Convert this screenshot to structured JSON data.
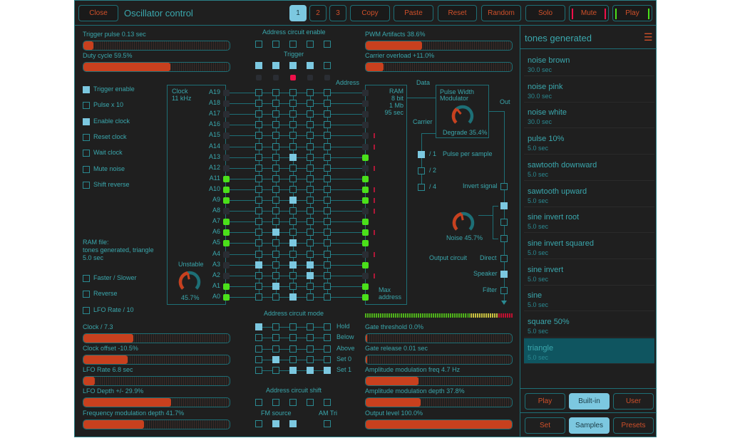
{
  "toolbar": {
    "close": "Close",
    "title": "Oscillator control",
    "pages": [
      "1",
      "2",
      "3"
    ],
    "active_page": "1",
    "copy": "Copy",
    "paste": "Paste",
    "reset": "Reset",
    "random": "Random",
    "solo": "Solo",
    "mute": "Mute",
    "play": "Play"
  },
  "sliders": {
    "trigger_pulse": {
      "label": "Trigger pulse 0.13 sec",
      "value": 7
    },
    "duty_cycle": {
      "label": "Duty cycle 59.5%",
      "value": 59.5
    },
    "pwm_artifacts": {
      "label": "PWM Artifacts 38.6%",
      "value": 38.6
    },
    "carrier_overload": {
      "label": "Carrier overload +11.0%",
      "value": 12
    },
    "clock_div": {
      "label": "Clock / 7.3",
      "value": 34
    },
    "clock_offset": {
      "label": "Clock offset -10.5%",
      "value": 30
    },
    "lfo_rate": {
      "label": "LFO Rate 6.8 sec",
      "value": 8
    },
    "lfo_depth": {
      "label": "LFO Depth +/- 29.9%",
      "value": 60
    },
    "fm_depth": {
      "label": "Frequency modulation depth 41.7%",
      "value": 41.7
    },
    "gate_threshold": {
      "label": "Gate threshold 0.0%",
      "value": 1
    },
    "gate_release": {
      "label": "Gate release 0.01 sec",
      "value": 1
    },
    "am_freq": {
      "label": "Amplitude modulation freq 4.7 Hz",
      "value": 36
    },
    "am_depth": {
      "label": "Amplitude modulation depth 37.8%",
      "value": 37.8
    },
    "output_level": {
      "label": "Output level 100.0%",
      "value": 100
    }
  },
  "options": [
    {
      "label": "Trigger enable",
      "checked": true
    },
    {
      "label": "Pulse x 10",
      "checked": false
    },
    {
      "label": "Enable clock",
      "checked": true
    },
    {
      "label": "Reset clock",
      "checked": false
    },
    {
      "label": "Wait clock",
      "checked": false
    },
    {
      "label": "Mute noise",
      "checked": false
    },
    {
      "label": "Shift reverse",
      "checked": false
    }
  ],
  "ram_file": {
    "line1": "RAM file:",
    "line2": "tones generated, triangle",
    "line3": "5.0 sec"
  },
  "ram_options": [
    {
      "label": "Faster / Slower",
      "checked": false
    },
    {
      "label": "Reverse",
      "checked": false
    },
    {
      "label": "LFO Rate / 10",
      "checked": false
    }
  ],
  "clock": {
    "label": "Clock",
    "freq": "11 kHz",
    "unstable_label": "Unstable",
    "unstable_value": "45.7%",
    "unstable_fraction": 0.457
  },
  "address": {
    "enable_label": "Address circuit enable",
    "enable": [
      false,
      false,
      false,
      false,
      false
    ],
    "trigger_label": "Trigger",
    "trigger": [
      true,
      true,
      true,
      true,
      false
    ],
    "trigger_leds": [
      false,
      false,
      true,
      false,
      false
    ],
    "address_label": "Address",
    "data_label": "Data",
    "rows": [
      {
        "label": "A19",
        "cols": [],
        "in": false,
        "out": false,
        "mark": false
      },
      {
        "label": "A18",
        "cols": [],
        "in": false,
        "out": false,
        "mark": false
      },
      {
        "label": "A17",
        "cols": [],
        "in": false,
        "out": false,
        "mark": false
      },
      {
        "label": "A16",
        "cols": [],
        "in": false,
        "out": false,
        "mark": false
      },
      {
        "label": "A15",
        "cols": [],
        "in": false,
        "out": false,
        "mark": true
      },
      {
        "label": "A14",
        "cols": [],
        "in": false,
        "out": false,
        "mark": true
      },
      {
        "label": "A13",
        "cols": [
          3
        ],
        "in": false,
        "out": true,
        "mark": false
      },
      {
        "label": "A12",
        "cols": [],
        "in": false,
        "out": false,
        "mark": true
      },
      {
        "label": "A11",
        "cols": [],
        "in": true,
        "out": true,
        "mark": false
      },
      {
        "label": "A10",
        "cols": [],
        "in": true,
        "out": true,
        "mark": true
      },
      {
        "label": "A9",
        "cols": [
          3
        ],
        "in": true,
        "out": true,
        "mark": true
      },
      {
        "label": "A8",
        "cols": [],
        "in": false,
        "out": false,
        "mark": true
      },
      {
        "label": "A7",
        "cols": [],
        "in": true,
        "out": true,
        "mark": false
      },
      {
        "label": "A6",
        "cols": [
          2
        ],
        "in": true,
        "out": true,
        "mark": true
      },
      {
        "label": "A5",
        "cols": [
          3
        ],
        "in": true,
        "out": true,
        "mark": false
      },
      {
        "label": "A4",
        "cols": [],
        "in": false,
        "out": false,
        "mark": true
      },
      {
        "label": "A3",
        "cols": [
          1,
          3,
          4
        ],
        "in": false,
        "out": true,
        "mark": false
      },
      {
        "label": "A2",
        "cols": [
          4
        ],
        "in": false,
        "out": false,
        "mark": true
      },
      {
        "label": "A1",
        "cols": [
          2
        ],
        "in": true,
        "out": true,
        "mark": false
      },
      {
        "label": "A0",
        "cols": [
          3
        ],
        "in": true,
        "out": true,
        "mark": false
      }
    ],
    "mode_label": "Address circuit mode",
    "modes": [
      {
        "label": "Hold",
        "cols": [
          1
        ]
      },
      {
        "label": "Below",
        "cols": []
      },
      {
        "label": "Above",
        "cols": []
      },
      {
        "label": "Set 0",
        "cols": [
          2
        ]
      },
      {
        "label": "Set 1",
        "cols": [
          3,
          4,
          5
        ]
      }
    ],
    "shift_label": "Address circuit shift",
    "shift": [
      false,
      false,
      false,
      false,
      false
    ],
    "fm_label": "FM source",
    "fm": [
      false,
      true,
      true
    ],
    "am_label": "AM Tri",
    "am": false
  },
  "ram": {
    "l1": "RAM",
    "l2": "8 bit",
    "l3": "1 Mb",
    "l4": "95 sec",
    "max1": "Max",
    "max2": "address"
  },
  "pwm": {
    "title1": "Pulse Width",
    "title2": "Modulator",
    "degrade": "Degrade 35.4%",
    "degrade_fraction": 0.354,
    "carrier": "Carrier",
    "out": "Out",
    "divs": [
      {
        "label": "/ 1",
        "checked": true
      },
      {
        "label": "/ 2",
        "checked": false
      },
      {
        "label": "/ 4",
        "checked": false
      }
    ],
    "pulse_per_sample": "Pulse per sample",
    "invert": "Invert signal",
    "invert_checked": false,
    "noise": "Noise 45.7%",
    "noise_fraction": 0.457,
    "noise_sel": [
      true,
      false,
      false
    ],
    "output_circuit": "Output circuit",
    "outputs": [
      {
        "label": "Direct",
        "checked": false
      },
      {
        "label": "Speaker",
        "checked": true
      },
      {
        "label": "Filter",
        "checked": false
      }
    ],
    "meter_level": 1.0
  },
  "sidebar": {
    "title": "tones generated",
    "items": [
      {
        "name": "noise brown",
        "dur": "30.0 sec"
      },
      {
        "name": "noise pink",
        "dur": "30.0 sec"
      },
      {
        "name": "noise white",
        "dur": "30.0 sec"
      },
      {
        "name": "pulse 10%",
        "dur": "5.0 sec"
      },
      {
        "name": "sawtooth downward",
        "dur": "5.0 sec"
      },
      {
        "name": "sawtooth upward",
        "dur": "5.0 sec"
      },
      {
        "name": "sine invert root",
        "dur": "5.0 sec"
      },
      {
        "name": "sine invert squared",
        "dur": "5.0 sec"
      },
      {
        "name": "sine invert",
        "dur": "5.0 sec"
      },
      {
        "name": "sine",
        "dur": "5.0 sec"
      },
      {
        "name": "square 50%",
        "dur": "5.0 sec"
      },
      {
        "name": "triangle",
        "dur": "5.0 sec"
      }
    ],
    "selected": 11,
    "play": "Play",
    "builtin": "Built-in",
    "user": "User",
    "set": "Set",
    "samples": "Samples",
    "presets": "Presets"
  },
  "colors": {
    "accent": "#3aa7ad",
    "orange": "#c8401e",
    "selected": "#7cc8e0",
    "green": "#4be01a",
    "red": "#f0104a"
  }
}
